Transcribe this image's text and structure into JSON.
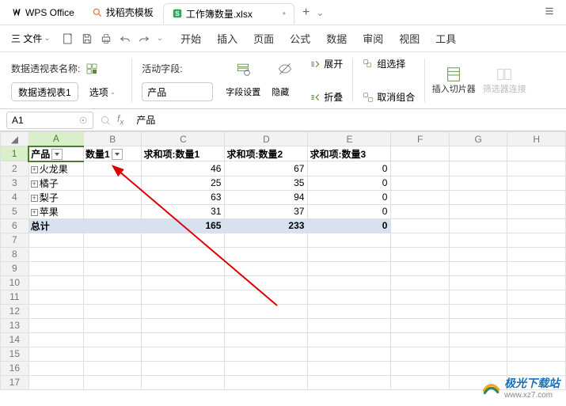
{
  "titlebar": {
    "app_name": "WPS Office",
    "tabs": [
      {
        "icon": "search-orange",
        "label": "找稻壳模板"
      },
      {
        "icon": "sheet-green",
        "label": "工作簿数量.xlsx"
      }
    ]
  },
  "menubar": {
    "file": "三 文件",
    "items": [
      "开始",
      "插入",
      "页面",
      "公式",
      "数据",
      "审阅",
      "视图",
      "工具"
    ]
  },
  "ribbon": {
    "pivotname_label": "数据透视表名称:",
    "pivotname_btn": "数据透视表1",
    "options_btn": "选项",
    "activefield_label": "活动字段:",
    "activefield_value": "产品",
    "field_settings": "字段设置",
    "hide": "隐藏",
    "expand": "展开",
    "collapse": "折叠",
    "group_select": "组选择",
    "ungroup": "取消组合",
    "slicer": "插入切片器",
    "filter_conn": "筛选器连接"
  },
  "namebox": {
    "cell": "A1",
    "formula": "产品"
  },
  "sheet": {
    "col_headers": [
      "A",
      "B",
      "C",
      "D",
      "E",
      "F",
      "G",
      "H"
    ],
    "row_headers": [
      1,
      2,
      3,
      4,
      5,
      6,
      7,
      8,
      9,
      10,
      11,
      12,
      13,
      14,
      15,
      16,
      17
    ],
    "pivot": {
      "hdrA": "产品",
      "hdrB": "数量1",
      "hdrC": "求和项:数量1",
      "hdrD": "求和项:数量2",
      "hdrE": "求和项:数量3",
      "rows": [
        {
          "name": "火龙果",
          "c": 46,
          "d": 67,
          "e": 0
        },
        {
          "name": "橘子",
          "c": 25,
          "d": 35,
          "e": 0
        },
        {
          "name": "梨子",
          "c": 63,
          "d": 94,
          "e": 0
        },
        {
          "name": "苹果",
          "c": 31,
          "d": 37,
          "e": 0
        }
      ],
      "total_label": "总计",
      "total": {
        "c": 165,
        "d": 233,
        "e": 0
      }
    }
  },
  "chart_data": {
    "type": "table",
    "title": "Pivot Table",
    "columns": [
      "产品",
      "求和项:数量1",
      "求和项:数量2",
      "求和项:数量3"
    ],
    "rows": [
      [
        "火龙果",
        46,
        67,
        0
      ],
      [
        "橘子",
        25,
        35,
        0
      ],
      [
        "梨子",
        63,
        94,
        0
      ],
      [
        "苹果",
        31,
        37,
        0
      ],
      [
        "总计",
        165,
        233,
        0
      ]
    ]
  },
  "watermark": {
    "line1": "极光下载站",
    "line2": "www.xz7.com"
  }
}
